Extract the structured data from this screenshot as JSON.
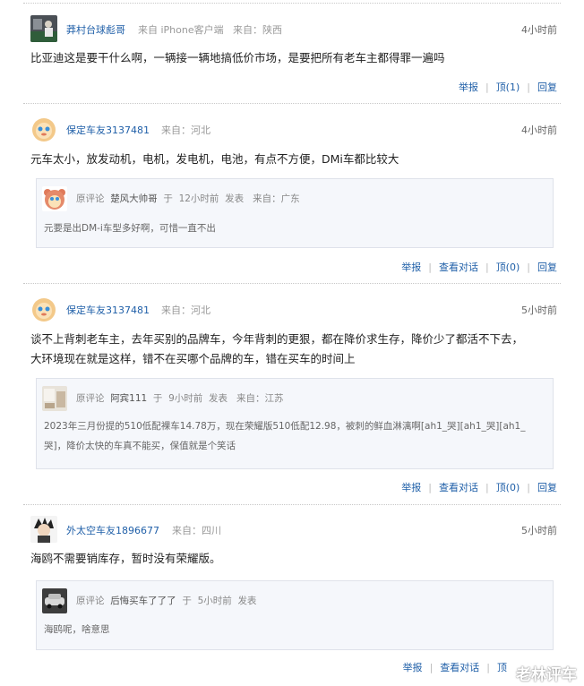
{
  "comments": [
    {
      "username": "莽村台球彪哥",
      "source": "来自 iPhone客户端",
      "location": "来自：陕西",
      "time": "4小时前",
      "text": "比亚迪这是要干什么啊，一辆接一辆地搞低价市场，是要把所有老车主都得罪一遍吗",
      "actions": {
        "report": "举报",
        "like": "顶(1)",
        "reply": "回复"
      }
    },
    {
      "username": "保定车友3137481",
      "location": "来自：河北",
      "time": "4小时前",
      "text": "元车太小，放发动机，电机，发电机，电池，有点不方便，DMi车都比较大",
      "quote": {
        "label": "原评论",
        "username": "楚风大帅哥",
        "at": "于",
        "time": "12小时前",
        "posted": "发表",
        "location": "来自：广东",
        "text": "元要是出DM-i车型多好啊，可惜一直不出"
      },
      "actions": {
        "report": "举报",
        "view": "查看对话",
        "like": "顶(0)",
        "reply": "回复"
      }
    },
    {
      "username": "保定车友3137481",
      "location": "来自：河北",
      "time": "5小时前",
      "text_line1": "谈不上背刺老车主，去年买别的品牌车，今年背刺的更狠，都在降价求生存，降价少了都活不下去，",
      "text_line2": "大环境现在就是这样，错不在买哪个品牌的车，错在买车的时间上",
      "quote": {
        "label": "原评论",
        "username": "阿宾111",
        "at": "于",
        "time": "9小时前",
        "posted": "发表",
        "location": "来自：江苏",
        "text_line1": "2023年三月份提的510低配裸车14.78万，现在荣耀版510低配12.98，被刺的鲜血淋漓啊[ah1_哭][ah1_哭][ah1_",
        "text_line2": "哭]，降价太快的车真不能买，保值就是个笑话"
      },
      "actions": {
        "report": "举报",
        "view": "查看对话",
        "like": "顶(0)",
        "reply": "回复"
      }
    },
    {
      "username": "外太空车友1896677",
      "location": "来自：四川",
      "time": "5小时前",
      "text": "海鸥不需要销库存，暂时没有荣耀版。",
      "quote": {
        "label": "原评论",
        "username": "后悔买车了了了",
        "at": "于",
        "time": "5小时前",
        "posted": "发表",
        "text": "海鸥呢，啥意思"
      },
      "actions": {
        "report": "举报",
        "view": "查看对话",
        "like": "顶",
        "reply": ""
      }
    }
  ],
  "watermark": "老林评车",
  "icons": {
    "avatar1": "billiards-user-photo",
    "avatar2": "cartoon-face-avatar",
    "avatar3": "dark-hair-character-avatar",
    "quote_avatar_bear": "bear-cartoon-avatar",
    "quote_avatar_room": "room-photo-avatar",
    "quote_avatar_car": "car-photo-avatar"
  },
  "colors": {
    "link": "#1f5fa8",
    "quote_bg": "#f5f7fb",
    "quote_border": "#dfe2ea"
  }
}
